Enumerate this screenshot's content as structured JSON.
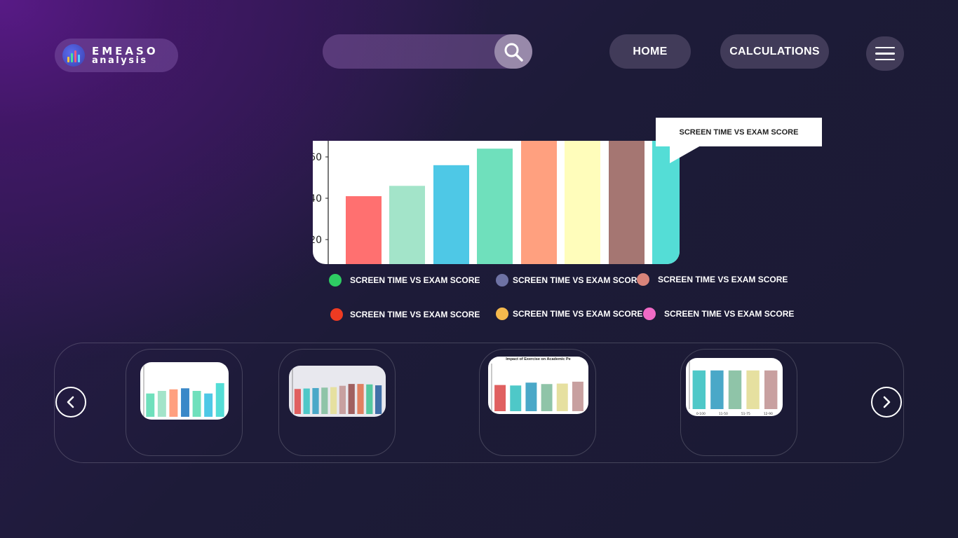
{
  "header": {
    "logo": {
      "line1": "EMEASO",
      "line2": "analysis"
    },
    "search": {
      "placeholder": "",
      "icon": "search-icon"
    },
    "nav": {
      "home": "HOME",
      "calculations": "CALCULATIONS"
    },
    "menu_icon": "hamburger-menu-icon"
  },
  "main_chart": {
    "tooltip": "SCREEN TIME VS EXAM SCORE",
    "chart_data": {
      "type": "bar",
      "yticks": [
        "20",
        "40",
        "60"
      ],
      "values": [
        41,
        46,
        56,
        64,
        72,
        72,
        72,
        72
      ],
      "colors": [
        "#ff7070",
        "#a3e4c9",
        "#4ec8e6",
        "#6fe0bc",
        "#ffa07f",
        "#fffdbb",
        "#a57672",
        "#54ddd6"
      ]
    }
  },
  "legend": [
    {
      "label": "SCREEN TIME VS EXAM SCORE",
      "color": "#2ecc63"
    },
    {
      "label": "SCREEN TIME VS EXAM SCORE",
      "color": "#6e72a4"
    },
    {
      "label": "SCREEN TIME VS EXAM SCORE",
      "color": "#d9847a"
    },
    {
      "label": "SCREEN TIME VS EXAM SCORE",
      "color": "#ee3b22"
    },
    {
      "label": "SCREEN TIME VS EXAM SCORE",
      "color": "#f5b94d"
    },
    {
      "label": "SCREEN TIME VS EXAM SCORE",
      "color": "#f06ac6"
    }
  ],
  "carousel": {
    "prev_icon": "chevron-left-icon",
    "next_icon": "chevron-right-icon",
    "thumbnails": [
      {
        "values": [
          45,
          50,
          53,
          55,
          50,
          45,
          65
        ],
        "colors": [
          "#6fe0bc",
          "#a3e4c9",
          "#ffa07f",
          "#3a88c8",
          "#6fe0bc",
          "#4ec8e6",
          "#54ddd6"
        ]
      },
      {
        "values": [
          55,
          56,
          57,
          58,
          59,
          62,
          66,
          66,
          65,
          63
        ],
        "colors": [
          "#e06060",
          "#4ec8c8",
          "#4aa8c8",
          "#8fc4a8",
          "#e6e0a0",
          "#c8a0a0",
          "#a06060",
          "#e08060",
          "#54c8a0",
          "#4070a8"
        ]
      },
      {
        "title": "Impact of Exercise on Academic Pe",
        "values": [
          55,
          54,
          60,
          57,
          58,
          62
        ],
        "colors": [
          "#e06060",
          "#4ec8c8",
          "#4aa8c8",
          "#8fc4a8",
          "#e6e0a0",
          "#c8a0a0"
        ]
      },
      {
        "xlabels": [
          "0-100",
          "11-50",
          "51-75",
          "12-90"
        ],
        "values": [
          80,
          80,
          80,
          80,
          80
        ],
        "colors": [
          "#4ec8c8",
          "#4aa8c8",
          "#8fc4a8",
          "#e6e0a0",
          "#c8a0a0"
        ]
      }
    ]
  }
}
